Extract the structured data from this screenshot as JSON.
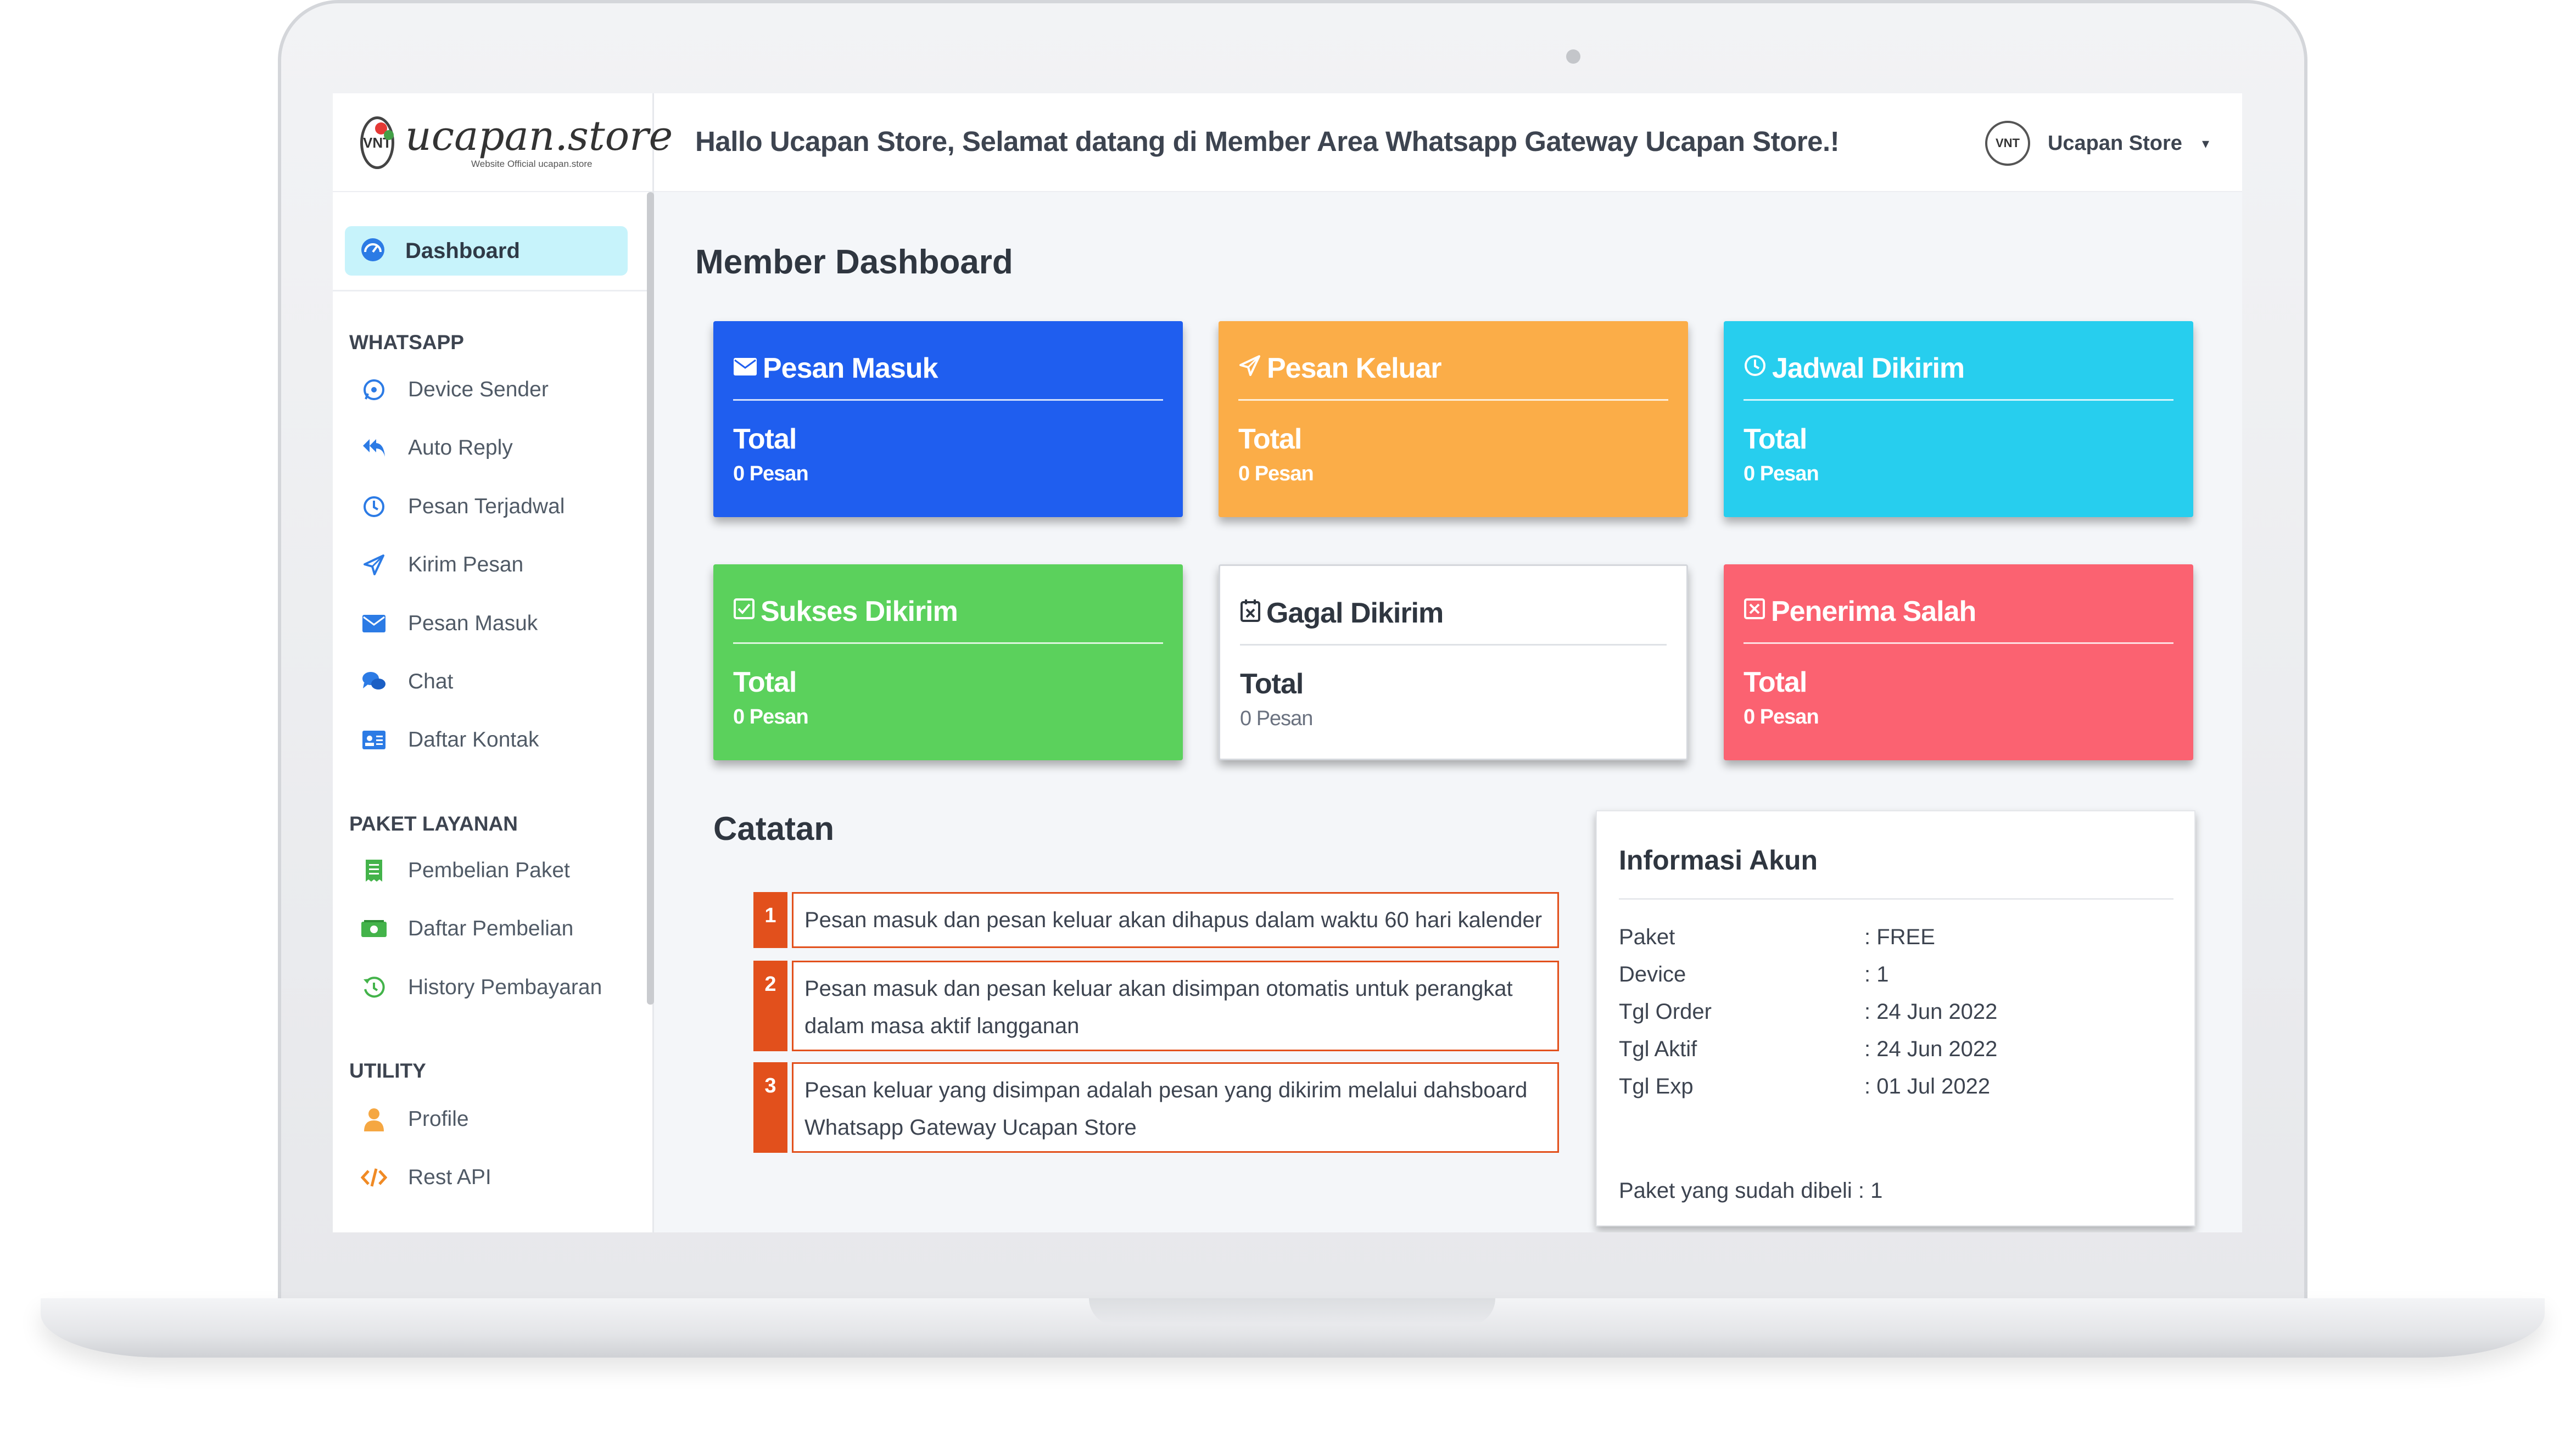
{
  "brand": {
    "logo_initials": "VNT",
    "name": "ucapan.store",
    "tagline": "Website Official ucapan.store"
  },
  "topbar": {
    "greeting": "Hallo Ucapan Store, Selamat datang di Member Area Whatsapp Gateway Ucapan Store.!",
    "user_name": "Ucapan Store",
    "user_initials": "VNT",
    "caret": "▾"
  },
  "sidebar": {
    "active": {
      "label": "Dashboard",
      "icon": "dashboard-icon"
    },
    "sections": [
      {
        "title": "WHATSAPP",
        "items": [
          {
            "label": "Device Sender",
            "icon": "whatsapp-icon"
          },
          {
            "label": "Auto Reply",
            "icon": "reply-all-icon"
          },
          {
            "label": "Pesan Terjadwal",
            "icon": "clock-icon"
          },
          {
            "label": "Kirim Pesan",
            "icon": "paper-plane-icon"
          },
          {
            "label": "Pesan Masuk",
            "icon": "envelope-icon"
          },
          {
            "label": "Chat",
            "icon": "chat-icon"
          },
          {
            "label": "Daftar Kontak",
            "icon": "contact-card-icon"
          }
        ]
      },
      {
        "title": "PAKET LAYANAN",
        "items": [
          {
            "label": "Pembelian Paket",
            "icon": "receipt-icon"
          },
          {
            "label": "Daftar Pembelian",
            "icon": "money-icon"
          },
          {
            "label": "History Pembayaran",
            "icon": "history-icon"
          }
        ]
      },
      {
        "title": "UTILITY",
        "items": [
          {
            "label": "Profile",
            "icon": "user-icon"
          },
          {
            "label": "Rest API",
            "icon": "code-icon"
          }
        ]
      }
    ]
  },
  "main": {
    "title": "Member Dashboard",
    "cards": [
      {
        "title": "Pesan Masuk",
        "icon": "envelope-icon",
        "total_label": "Total",
        "count": "0 Pesan",
        "color": "#1f5eef"
      },
      {
        "title": "Pesan Keluar",
        "icon": "paper-plane-icon",
        "total_label": "Total",
        "count": "0 Pesan",
        "color": "#fbad48"
      },
      {
        "title": "Jadwal Dikirim",
        "icon": "clock-icon",
        "total_label": "Total",
        "count": "0 Pesan",
        "color": "#27ceee"
      },
      {
        "title": "Sukses Dikirim",
        "icon": "check-square-icon",
        "total_label": "Total",
        "count": "0 Pesan",
        "color": "#5bd15c"
      },
      {
        "title": "Gagal Dikirim",
        "icon": "calendar-x-icon",
        "total_label": "Total",
        "count": "0 Pesan",
        "color": "#ffffff"
      },
      {
        "title": "Penerima Salah",
        "icon": "x-square-icon",
        "total_label": "Total",
        "count": "0 Pesan",
        "color": "#fb6271"
      }
    ],
    "catatan": {
      "title": "Catatan",
      "notes": [
        {
          "num": "1",
          "text": "Pesan masuk dan pesan keluar akan dihapus dalam waktu 60 hari kalender"
        },
        {
          "num": "2",
          "text": "Pesan masuk dan pesan keluar akan disimpan otomatis untuk perangkat dalam masa aktif langganan"
        },
        {
          "num": "3",
          "text": "Pesan keluar yang disimpan adalah pesan yang dikirim melalui dahsboard Whatsapp Gateway Ucapan Store"
        }
      ]
    },
    "info": {
      "title": "Informasi Akun",
      "rows": [
        {
          "key": "Paket",
          "value": ": FREE"
        },
        {
          "key": "Device",
          "value": ": 1"
        },
        {
          "key": "Tgl Order",
          "value": ": 24 Jun 2022"
        },
        {
          "key": "Tgl Aktif",
          "value": ": 24 Jun 2022"
        },
        {
          "key": "Tgl Exp",
          "value": ": 01 Jul 2022"
        }
      ],
      "footer": "Paket yang sudah dibeli : 1"
    }
  }
}
